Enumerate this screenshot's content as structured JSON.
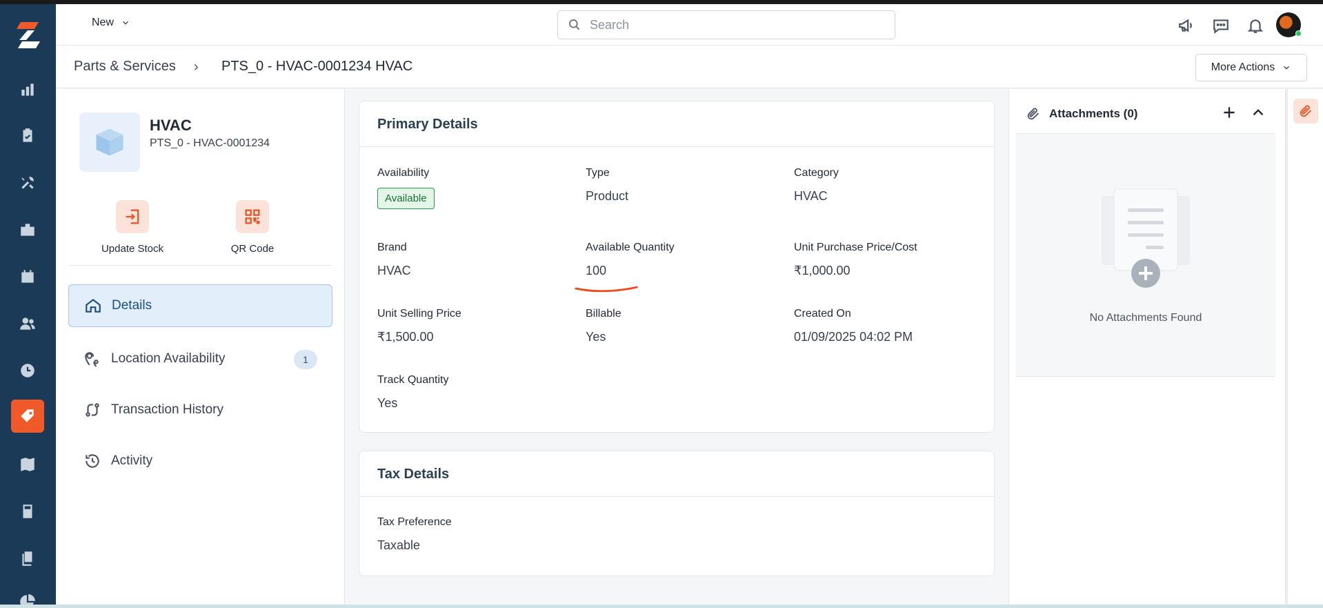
{
  "header": {
    "new_label": "New",
    "search_placeholder": "Search"
  },
  "breadcrumb": {
    "root": "Parts & Services",
    "separator": "›",
    "current": "PTS_0 - HVAC-0001234 HVAC"
  },
  "more_actions_label": "More Actions",
  "product": {
    "name": "HVAC",
    "code": "PTS_0 - HVAC-0001234"
  },
  "quick_actions": {
    "update_stock": "Update Stock",
    "qr_code": "QR Code"
  },
  "side_menu": {
    "details": "Details",
    "location_availability": "Location Availability",
    "location_count": "1",
    "transaction_history": "Transaction History",
    "activity": "Activity"
  },
  "primary_details": {
    "title": "Primary Details",
    "availability_label": "Availability",
    "availability_value": "Available",
    "type_label": "Type",
    "type_value": "Product",
    "category_label": "Category",
    "category_value": "HVAC",
    "brand_label": "Brand",
    "brand_value": "HVAC",
    "available_qty_label": "Available Quantity",
    "available_qty_value": "100",
    "unit_purchase_label": "Unit Purchase Price/Cost",
    "unit_purchase_value": "₹1,000.00",
    "unit_selling_label": "Unit Selling Price",
    "unit_selling_value": "₹1,500.00",
    "billable_label": "Billable",
    "billable_value": "Yes",
    "created_on_label": "Created On",
    "created_on_value": "01/09/2025 04:02 PM",
    "track_qty_label": "Track Quantity",
    "track_qty_value": "Yes"
  },
  "tax_details": {
    "title": "Tax Details",
    "tax_pref_label": "Tax Preference",
    "tax_pref_value": "Taxable"
  },
  "attachments": {
    "title": "Attachments (0)",
    "empty_text": "No Attachments Found"
  },
  "colors": {
    "nav_bg": "#1b3a57",
    "accent": "#f05a28",
    "active_blue": "#1b4f86",
    "available_green": "#22a04b"
  }
}
